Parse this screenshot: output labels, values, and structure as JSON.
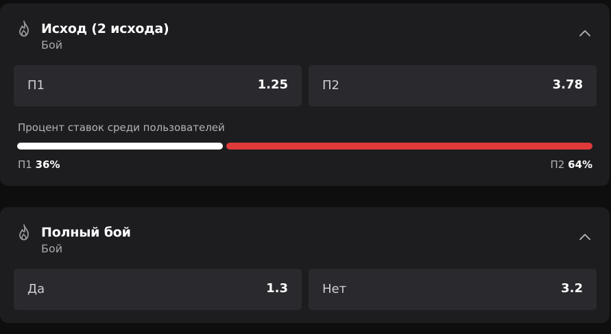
{
  "colors": {
    "background": "#0e0e0f",
    "card": "#1d1d20",
    "odd_button": "#2a2a2e",
    "bar_p1": "#ffffff",
    "bar_p2": "#e03a3a"
  },
  "market_1": {
    "icon": "fire-icon",
    "title": "Исход (2 исхода)",
    "subtitle": "Бой",
    "collapse_icon": "chevron-up-icon",
    "odds": [
      {
        "label": "П1",
        "value": "1.25"
      },
      {
        "label": "П2",
        "value": "3.78"
      }
    ],
    "percent_title": "Процент ставок среди пользователей",
    "split": [
      {
        "label": "П1",
        "value": "36%",
        "fraction": 0.36
      },
      {
        "label": "П2",
        "value": "64%",
        "fraction": 0.64
      }
    ]
  },
  "market_2": {
    "icon": "fire-icon",
    "title": "Полный бой",
    "subtitle": "Бой",
    "collapse_icon": "chevron-up-icon",
    "odds": [
      {
        "label": "Да",
        "value": "1.3"
      },
      {
        "label": "Нет",
        "value": "3.2"
      }
    ]
  }
}
